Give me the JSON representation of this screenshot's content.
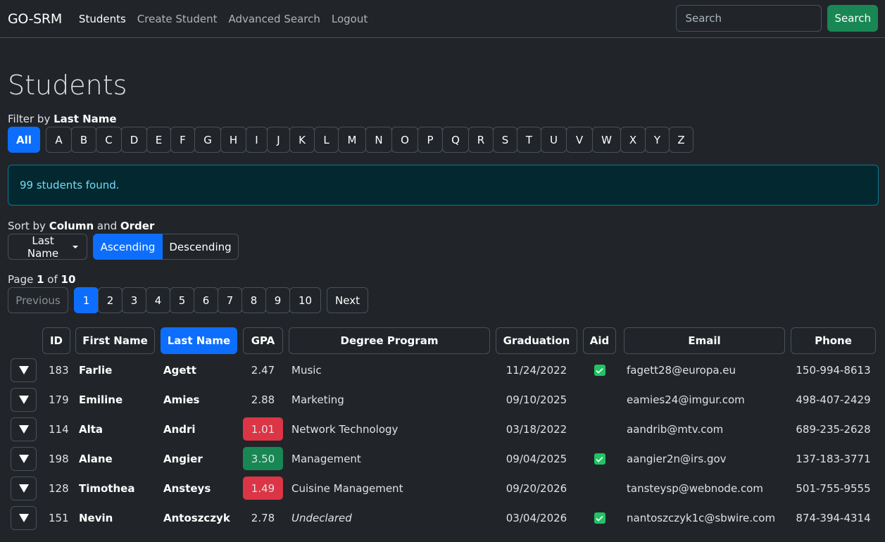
{
  "navbar": {
    "brand": "GO-SRM",
    "links": [
      {
        "label": "Students",
        "active": true
      },
      {
        "label": "Create Student",
        "active": false
      },
      {
        "label": "Advanced Search",
        "active": false
      },
      {
        "label": "Logout",
        "active": false
      }
    ],
    "search_placeholder": "Search",
    "search_value": "",
    "search_button": "Search"
  },
  "page": {
    "title": "Students",
    "filter_label_prefix": "Filter by ",
    "filter_label_bold": "Last Name",
    "filter_all": "All",
    "filter_letters": [
      "A",
      "B",
      "C",
      "D",
      "E",
      "F",
      "G",
      "H",
      "I",
      "J",
      "K",
      "L",
      "M",
      "N",
      "O",
      "P",
      "Q",
      "R",
      "S",
      "T",
      "U",
      "V",
      "W",
      "X",
      "Y",
      "Z"
    ],
    "selected_filter": "All",
    "alert_text": "99 students found.",
    "sort_label_prefix": "Sort by ",
    "sort_label_column": "Column",
    "sort_label_and": " and ",
    "sort_label_order": "Order",
    "sort_column": "Last Name",
    "sort_asc": "Ascending",
    "sort_desc": "Descending",
    "sort_order_selected": "Ascending",
    "page_label_prefix": "Page ",
    "current_page": "1",
    "page_label_of": " of ",
    "total_pages": "10",
    "prev_label": "Previous",
    "next_label": "Next",
    "pages": [
      "1",
      "2",
      "3",
      "4",
      "5",
      "6",
      "7",
      "8",
      "9",
      "10"
    ]
  },
  "table": {
    "columns": [
      "ID",
      "First Name",
      "Last Name",
      "GPA",
      "Degree Program",
      "Graduation",
      "Aid",
      "Email",
      "Phone"
    ],
    "sorted_column": "Last Name",
    "colors": {
      "gpa_low": "#dc3545",
      "gpa_high": "#198754",
      "aid_check": "#20c464",
      "primary": "#0d6efd"
    },
    "rows": [
      {
        "id": "183",
        "first": "Farlie",
        "last": "Agett",
        "gpa": "2.47",
        "gpa_status": "normal",
        "program": "Music",
        "program_italic": false,
        "graduation": "11/24/2022",
        "aid": true,
        "email": "fagett28@europa.eu",
        "phone": "150-994-8613"
      },
      {
        "id": "179",
        "first": "Emiline",
        "last": "Amies",
        "gpa": "2.88",
        "gpa_status": "normal",
        "program": "Marketing",
        "program_italic": false,
        "graduation": "09/10/2025",
        "aid": false,
        "email": "eamies24@imgur.com",
        "phone": "498-407-2429"
      },
      {
        "id": "114",
        "first": "Alta",
        "last": "Andri",
        "gpa": "1.01",
        "gpa_status": "low",
        "program": "Network Technology",
        "program_italic": false,
        "graduation": "03/18/2022",
        "aid": false,
        "email": "aandrib@mtv.com",
        "phone": "689-235-2628"
      },
      {
        "id": "198",
        "first": "Alane",
        "last": "Angier",
        "gpa": "3.50",
        "gpa_status": "high",
        "program": "Management",
        "program_italic": false,
        "graduation": "09/04/2025",
        "aid": true,
        "email": "aangier2n@irs.gov",
        "phone": "137-183-3771"
      },
      {
        "id": "128",
        "first": "Timothea",
        "last": "Ansteys",
        "gpa": "1.49",
        "gpa_status": "low",
        "program": "Cuisine Management",
        "program_italic": false,
        "graduation": "09/20/2026",
        "aid": false,
        "email": "tansteysp@webnode.com",
        "phone": "501-755-9555"
      },
      {
        "id": "151",
        "first": "Nevin",
        "last": "Antoszczyk",
        "gpa": "2.78",
        "gpa_status": "normal",
        "program": "Undeclared",
        "program_italic": true,
        "graduation": "03/04/2026",
        "aid": true,
        "email": "nantoszczyk1c@sbwire.com",
        "phone": "874-394-4314"
      }
    ]
  }
}
